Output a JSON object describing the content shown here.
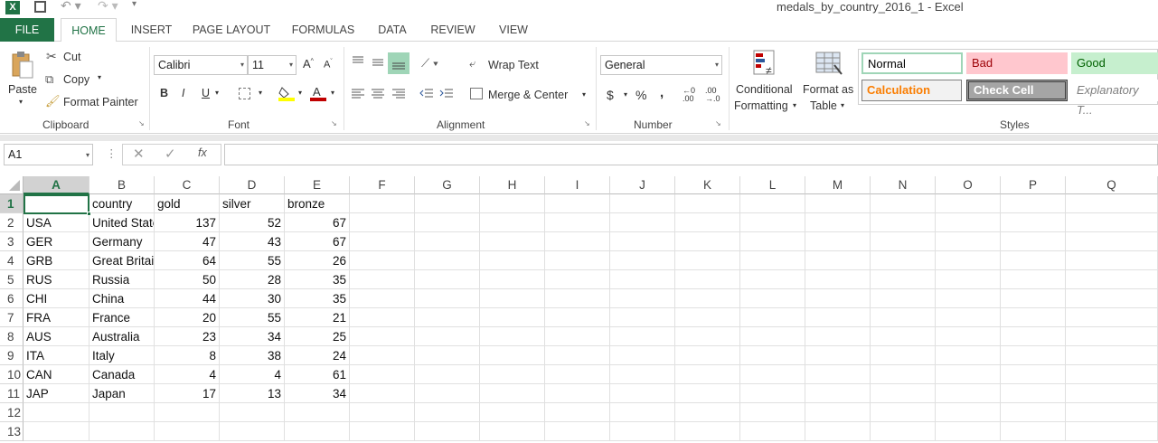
{
  "window": {
    "title": "medals_by_country_2016_1 - Excel"
  },
  "tabs": [
    "FILE",
    "HOME",
    "INSERT",
    "PAGE LAYOUT",
    "FORMULAS",
    "DATA",
    "REVIEW",
    "VIEW"
  ],
  "clipboard": {
    "paste": "Paste",
    "cut": "Cut",
    "copy": "Copy",
    "format_painter": "Format Painter",
    "label": "Clipboard"
  },
  "font": {
    "name": "Calibri",
    "size": "11",
    "label": "Font",
    "bold": "B",
    "italic": "I",
    "underline": "U"
  },
  "alignment": {
    "wrap": "Wrap Text",
    "merge": "Merge & Center",
    "label": "Alignment"
  },
  "number": {
    "format": "General",
    "currency": "$",
    "percent": "%",
    "comma": ",",
    "inc_dec": ".0→.00",
    "dec_dec": ".00→.0",
    "label": "Number"
  },
  "styles": {
    "conditional_1": "Conditional",
    "conditional_2": "Formatting",
    "format_table_1": "Format as",
    "format_table_2": "Table",
    "normal": "Normal",
    "bad": "Bad",
    "good": "Good",
    "calculation": "Calculation",
    "check_cell": "Check Cell",
    "explanatory": "Explanatory T...",
    "label": "Styles",
    "colors": {
      "bad_bg": "#ffc7ce",
      "bad_fg": "#9c0006",
      "good_bg": "#c6efce",
      "good_fg": "#006100",
      "calc_fg": "#fa7d00",
      "check_bg": "#a5a5a5"
    }
  },
  "formula_bar": {
    "name_box": "A1",
    "fx": "fx",
    "content": ""
  },
  "sheet": {
    "columns": [
      "A",
      "B",
      "C",
      "D",
      "E",
      "F",
      "G",
      "H",
      "I",
      "J",
      "K",
      "L",
      "M",
      "N",
      "O",
      "P",
      "Q"
    ],
    "rows": [
      "1",
      "2",
      "3",
      "4",
      "5",
      "6",
      "7",
      "8",
      "9",
      "10",
      "11",
      "12",
      "13"
    ],
    "headers": [
      "",
      "country",
      "gold",
      "silver",
      "bronze"
    ],
    "data": [
      [
        "USA",
        "United States",
        "137",
        "52",
        "67"
      ],
      [
        "GER",
        "Germany",
        "47",
        "43",
        "67"
      ],
      [
        "GRB",
        "Great Britain",
        "64",
        "55",
        "26"
      ],
      [
        "RUS",
        "Russia",
        "50",
        "28",
        "35"
      ],
      [
        "CHI",
        "China",
        "44",
        "30",
        "35"
      ],
      [
        "FRA",
        "France",
        "20",
        "55",
        "21"
      ],
      [
        "AUS",
        "Australia",
        "23",
        "34",
        "25"
      ],
      [
        "ITA",
        "Italy",
        "8",
        "38",
        "24"
      ],
      [
        "CAN",
        "Canada",
        "4",
        "4",
        "61"
      ],
      [
        "JAP",
        "Japan",
        "17",
        "13",
        "34"
      ]
    ],
    "accent": "#217346"
  }
}
